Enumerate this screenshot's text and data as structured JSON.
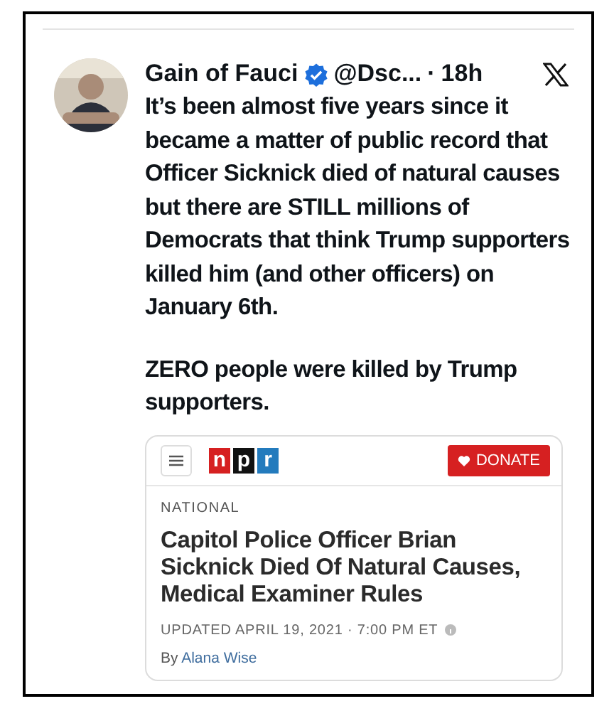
{
  "tweet": {
    "author": {
      "name": "Gain of Fauci",
      "verified": true,
      "handle": "@Dsc...",
      "separator": "·",
      "time": "18h"
    },
    "paragraphs": [
      "It’s been almost five years since it became a matter of public record that Officer Sicknick died of natural causes but there are STILL millions of Democrats that think Trump supporters killed him (and other officers) on January 6th.",
      "ZERO people were killed by Trump supporters."
    ]
  },
  "card": {
    "logo_letters": [
      {
        "text": "n",
        "color": "#d62021"
      },
      {
        "text": "p",
        "color": "#111111"
      },
      {
        "text": "r",
        "color": "#237bbd"
      }
    ],
    "donate": {
      "label": "DONATE"
    },
    "section": "NATIONAL",
    "headline": "Capitol Police Officer Brian Sicknick Died Of Natural Causes, Medical Examiner Rules",
    "updated": "UPDATED APRIL 19, 2021 · 7:00 PM ET",
    "byline": {
      "prefix": "By",
      "author": "Alana Wise"
    }
  }
}
